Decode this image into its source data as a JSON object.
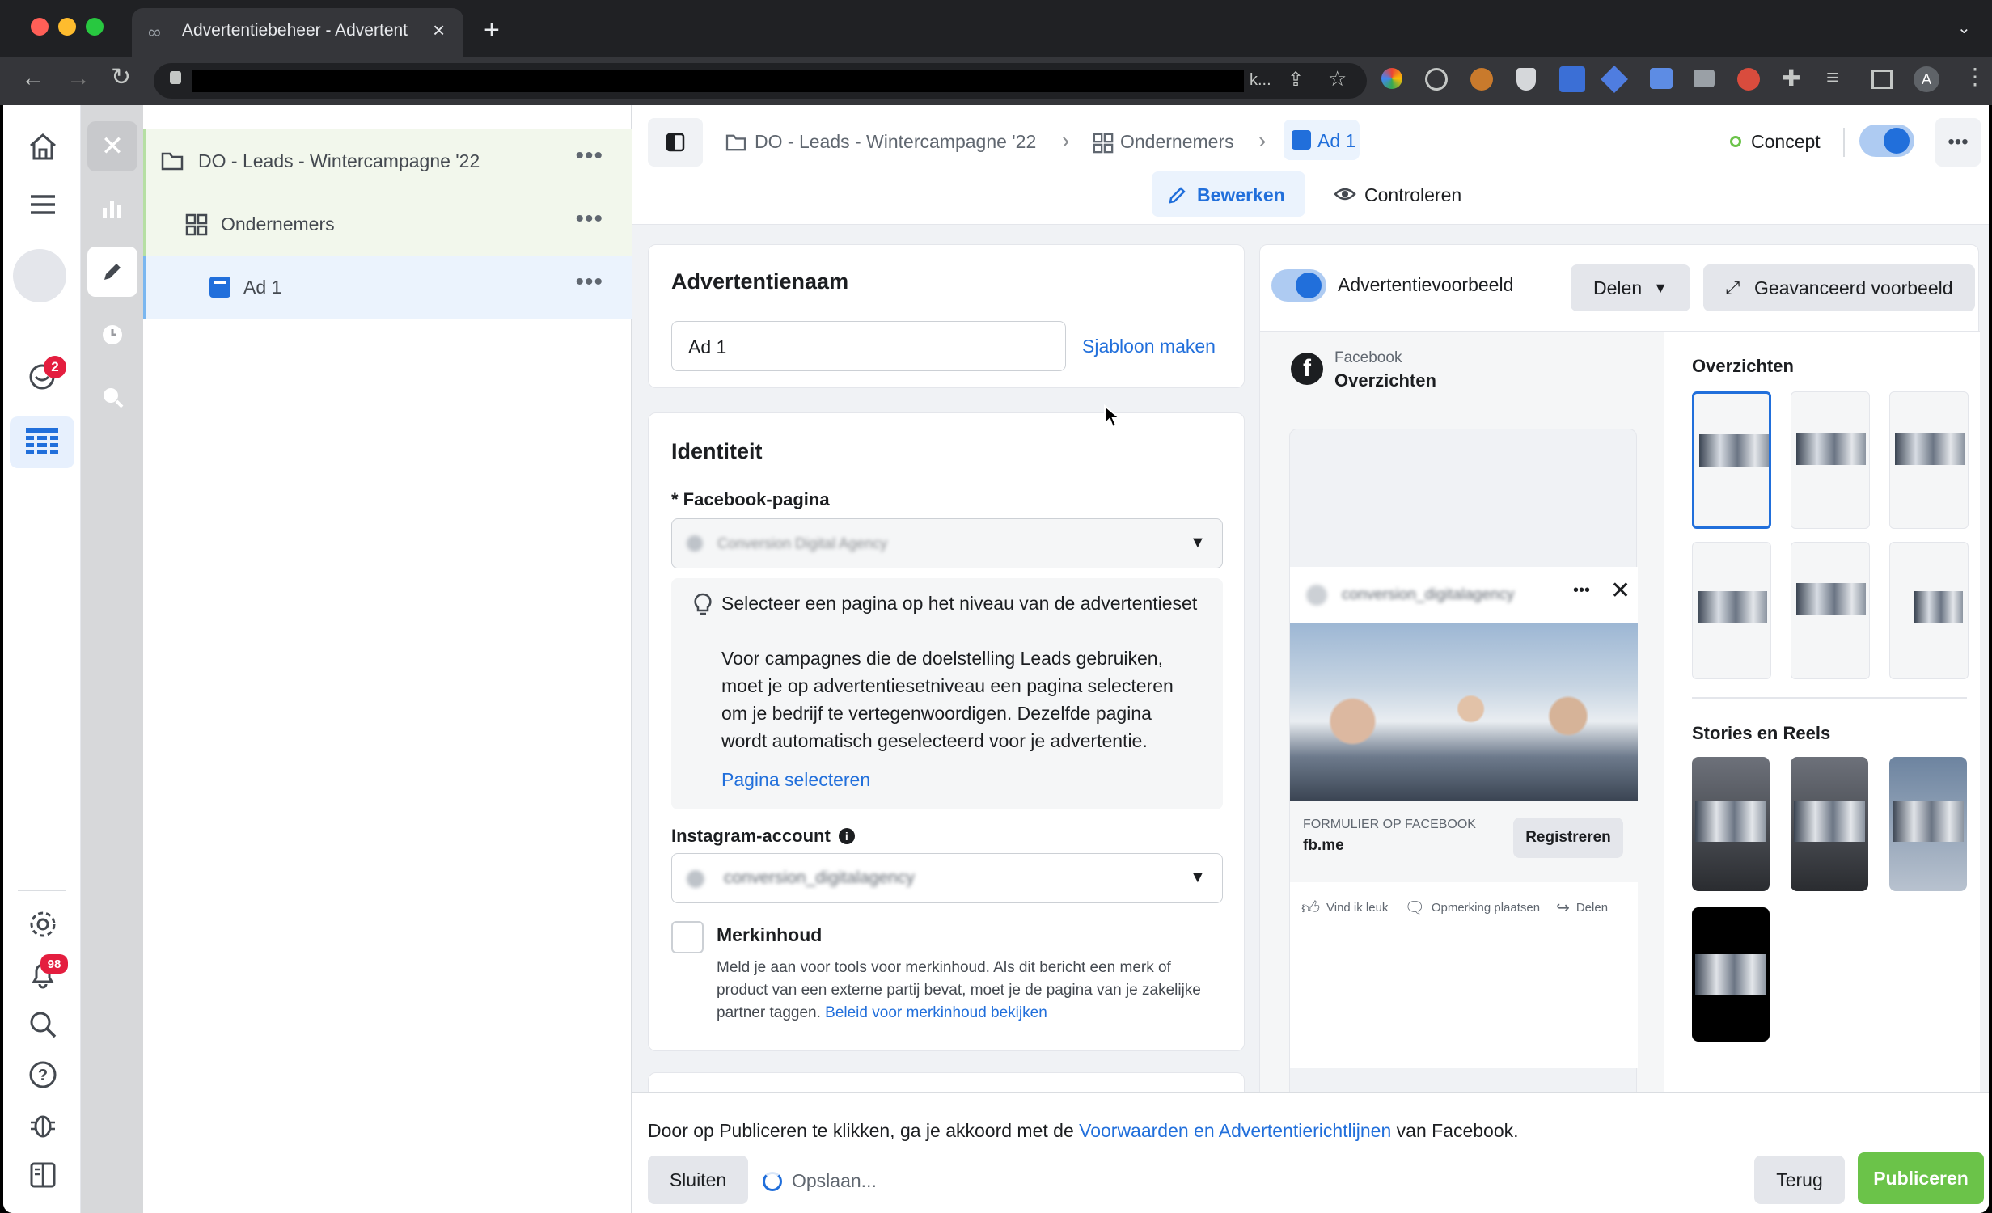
{
  "browser": {
    "tab_title": "Advertentiebeheer - Advertent",
    "address": "k..."
  },
  "tree": {
    "campaign": "DO - Leads - Wintercampagne '22",
    "adset": "Ondernemers",
    "ad": "Ad 1"
  },
  "rail": {
    "notification_badge": "2",
    "alerts_badge": "98"
  },
  "header": {
    "breadcrumb_campaign": "DO - Leads - Wintercampagne '22",
    "breadcrumb_adset": "Ondernemers",
    "breadcrumb_ad": "Ad 1",
    "status": "Concept",
    "edit_tab": "Bewerken",
    "review_tab": "Controleren"
  },
  "adname": {
    "title": "Advertentienaam",
    "value": "Ad 1",
    "template_link": "Sjabloon maken"
  },
  "identity": {
    "title": "Identiteit",
    "fb_label": "* Facebook-pagina",
    "fb_page_value": "Conversion Digital Agency",
    "tip_title": "Selecteer een pagina op het niveau van de advertentieset",
    "tip_body": "Voor campagnes die de doelstelling Leads gebruiken, moet je op advertentiesetniveau een pagina selecteren om je bedrijf te vertegenwoordigen. Dezelfde pagina wordt automatisch geselecteerd voor je advertentie.",
    "tip_link": "Pagina selecteren",
    "ig_label": "Instagram-account",
    "ig_value": "conversion_digitalagency",
    "brand_title": "Merkinhoud",
    "brand_body": "Meld je aan voor tools voor merkinhoud. Als dit bericht een merk of product van een externe partij bevat, moet je de pagina van je zakelijke partner taggen.",
    "brand_link": "Beleid voor merkinhoud bekijken"
  },
  "preview": {
    "toggle_label": "Advertentievoorbeeld",
    "share_label": "Delen",
    "advanced_label": "Geavanceerd voorbeeld",
    "platform": "Facebook",
    "placement": "Overzichten",
    "account_name": "conversion_digitalagency",
    "cta_caption": "FORMULIER OP FACEBOOK",
    "cta_domain": "fb.me",
    "cta_button": "Registreren",
    "like": "Vind ik leuk",
    "comment": "Opmerking plaatsen",
    "share": "Delen",
    "feeds_title": "Overzichten",
    "stories_title": "Stories en Reels"
  },
  "footer": {
    "terms_prefix": "Door op Publiceren te klikken, ga je akkoord met de",
    "terms_link": "Voorwaarden en Advertentierichtlijnen",
    "terms_suffix": "van Facebook.",
    "close": "Sluiten",
    "saving": "Opslaan...",
    "back": "Terug",
    "publish": "Publiceren"
  },
  "colors": {
    "accent": "#216fdb",
    "publish": "#6bc349",
    "status_dot": "#6bc349",
    "badge": "#e41e3f"
  }
}
